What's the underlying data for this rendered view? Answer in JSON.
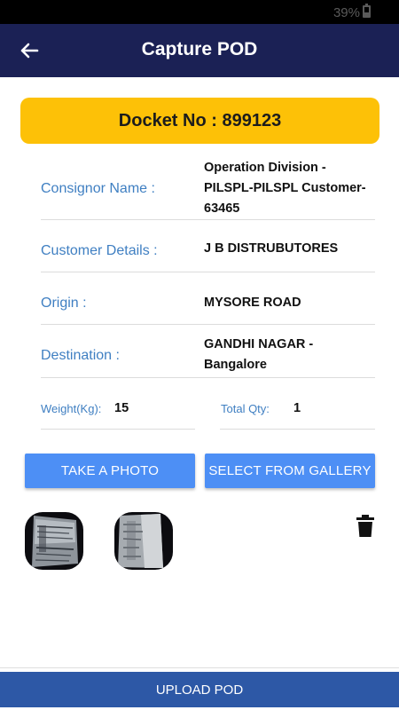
{
  "status_bar": {
    "battery": "39%"
  },
  "app_bar": {
    "title": "Capture POD",
    "back_icon": "arrow-left-icon"
  },
  "docket": {
    "text": "Docket No : 899123"
  },
  "details": [
    {
      "label": "Consignor Name :",
      "value": "Operation Division - PILSPL-PILSPL Customer-63465"
    },
    {
      "label": "Customer Details :",
      "value": "J B DISTRUBUTORES"
    },
    {
      "label": "Origin :",
      "value": "MYSORE ROAD"
    },
    {
      "label": "Destination :",
      "value": "GANDHI NAGAR - Bangalore"
    }
  ],
  "weight": {
    "label": "Weight(Kg):",
    "value": "15"
  },
  "total_qty": {
    "label": "Total Qty:",
    "value": "1"
  },
  "buttons": {
    "take_photo": "TAKE A PHOTO",
    "gallery": "SELECT FROM GALLERY"
  },
  "photos": [
    "pod-photo-1",
    "pod-photo-2"
  ],
  "delete_icon": "trash-icon",
  "upload": {
    "label": "UPLOAD POD"
  },
  "colors": {
    "app_bar": "#1b2155",
    "docket_banner": "#fdc107",
    "button": "#4d8ff5",
    "upload": "#2d58a6",
    "label": "#3f7fc2"
  }
}
